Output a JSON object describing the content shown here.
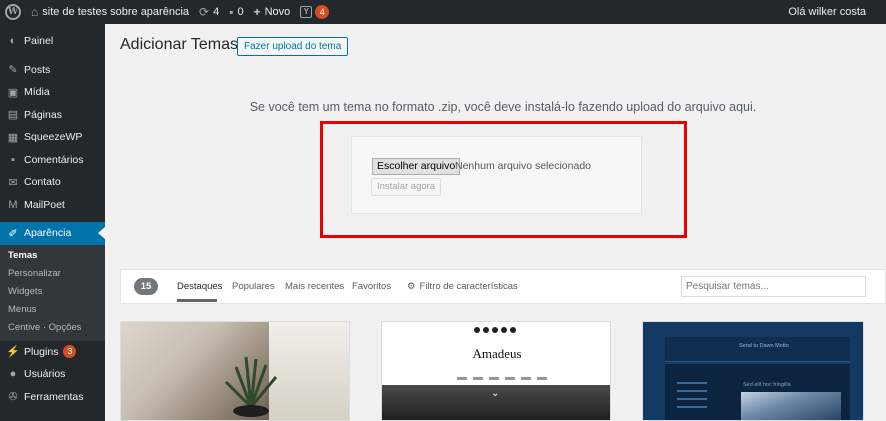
{
  "adminbar": {
    "site_name": "site de testes sobre aparência",
    "updates_count": "4",
    "comments_count": "0",
    "new_label": "Novo",
    "yoast_badge": "4",
    "greeting": "Olá wilker costa"
  },
  "sidebar": {
    "items": [
      {
        "label": "Painel",
        "icon": "dashboard-icon"
      },
      {
        "label": "Posts",
        "icon": "pin-icon"
      },
      {
        "label": "Mídia",
        "icon": "media-icon"
      },
      {
        "label": "Páginas",
        "icon": "pages-icon"
      },
      {
        "label": "SqueezeWP",
        "icon": "squeeze-icon"
      },
      {
        "label": "Comentários",
        "icon": "comment-icon"
      },
      {
        "label": "Contato",
        "icon": "mail-icon"
      },
      {
        "label": "MailPoet",
        "icon": "mailpoet-icon"
      },
      {
        "label": "Aparência",
        "icon": "brush-icon"
      },
      {
        "label": "Plugins",
        "icon": "plugin-icon",
        "badge": "3"
      },
      {
        "label": "Usuários",
        "icon": "users-icon"
      },
      {
        "label": "Ferramentas",
        "icon": "tools-icon"
      }
    ],
    "submenu": [
      "Temas",
      "Personalizar",
      "Widgets",
      "Menus",
      "Centive · Opções"
    ]
  },
  "main": {
    "title": "Adicionar Temas",
    "upload_button": "Fazer upload do tema",
    "upload_text": "Se você tem um tema no formato .zip, você deve instalá-lo fazendo upload do arquivo aqui.",
    "choose_file": "Escolher arquivo",
    "no_file": "Nenhum arquivo selecionado",
    "install_now": "Instalar agora"
  },
  "filters": {
    "count": "15",
    "tabs": [
      "Destaques",
      "Populares",
      "Mais recentes",
      "Favoritos"
    ],
    "active_tab": "Destaques",
    "feature_filter": "Filtro de características",
    "search_placeholder": "Pesquisar temas..."
  },
  "themes": {
    "card2_brand": "Amadeus",
    "card3_header": "Send to Dawn Motto",
    "card3_sub": "Sed elit hoc fringilla"
  },
  "colors": {
    "adminbar_bg": "#23282d",
    "sidebar_bg": "#23282d",
    "accent": "#0073aa",
    "badge": "#d54e21",
    "highlight_frame": "#ee0000"
  }
}
